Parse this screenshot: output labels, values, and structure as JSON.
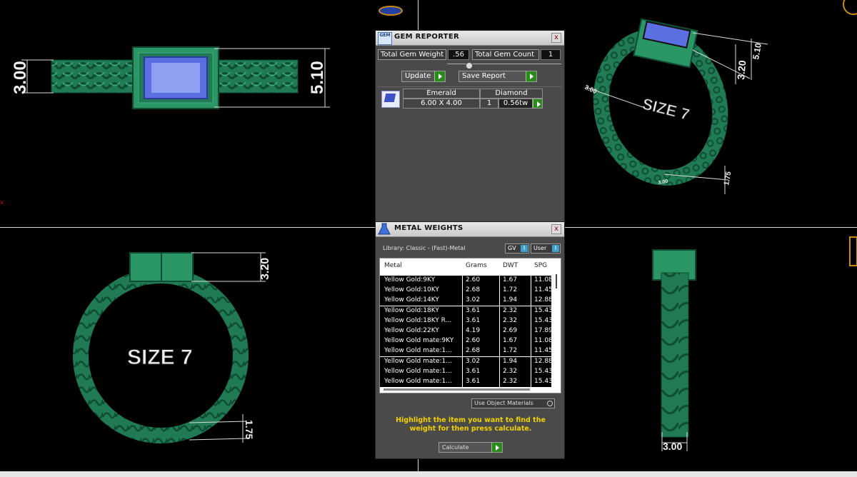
{
  "gem_reporter": {
    "title": "GEM REPORTER",
    "icon_text": "GEM",
    "close_glyph": "x",
    "total_gem_weight_label": "Total Gem Weight",
    "total_gem_weight_value": ".56",
    "total_gem_count_label": "Total Gem Count",
    "total_gem_count_value": "1",
    "update_label": "Update",
    "save_report_label": "Save Report",
    "gem_row": {
      "shape": "Emerald",
      "size": "6.00 X 4.00",
      "stone": "Diamond",
      "count": "1",
      "weight": "0.56tw"
    }
  },
  "metal_weights": {
    "title": "METAL WEIGHTS",
    "close_glyph": "x",
    "library_label": "Library: Classic - (Fast)-Metal",
    "gv_label": "GV",
    "user_label": "User",
    "toggle_glyph": "I",
    "columns": [
      "Metal",
      "Grams",
      "DWT",
      "SPG"
    ],
    "rows": [
      [
        "Yellow Gold:9KY",
        "2.60",
        "1.67",
        "11.08"
      ],
      [
        "Yellow Gold:10KY",
        "2.68",
        "1.72",
        "11.45"
      ],
      [
        "Yellow Gold:14KY",
        "3.02",
        "1.94",
        "12.88"
      ],
      [
        "Yellow Gold:18KY",
        "3.61",
        "2.32",
        "15.43"
      ],
      [
        "Yellow Gold:18KY R...",
        "3.61",
        "2.32",
        "15.43"
      ],
      [
        "Yellow Gold:22KY",
        "4.19",
        "2.69",
        "17.89"
      ],
      [
        "Yellow Gold mate:9KY",
        "2.60",
        "1.67",
        "11.08"
      ],
      [
        "Yellow Gold mate:1...",
        "2.68",
        "1.72",
        "11.45"
      ],
      [
        "Yellow Gold mate:1...",
        "3.02",
        "1.94",
        "12.88"
      ],
      [
        "Yellow Gold mate:1...",
        "3.61",
        "2.32",
        "15.43"
      ],
      [
        "Yellow Gold mate:1...",
        "3.61",
        "2.32",
        "15.43"
      ]
    ],
    "use_object_materials_label": "Use Object Materials",
    "instruction": "Highlight the item you want to find the weight for then press calculate.",
    "calculate_label": "Calculate"
  },
  "viewport": {
    "top_left": {
      "dim_height": "3.00",
      "dim_length": "5.10"
    },
    "top_right": {
      "size_label": "SIZE 7",
      "dim_a": "5.10",
      "dim_b": "3.20",
      "dim_c": "3.00",
      "dim_d": "1.75",
      "dim_e": "3.00"
    },
    "bottom_left": {
      "size_label": "SIZE 7",
      "dim_top": "3.20",
      "dim_band": "1.75"
    },
    "bottom_right": {
      "dim_width": "3.00"
    }
  },
  "colors": {
    "ring_green": "#1f7a55",
    "gem_blue": "#5b6fe0",
    "panel_bg": "#4a4a4a",
    "instruction_text": "#f2d100",
    "accent_button": "#2c8a1c"
  }
}
